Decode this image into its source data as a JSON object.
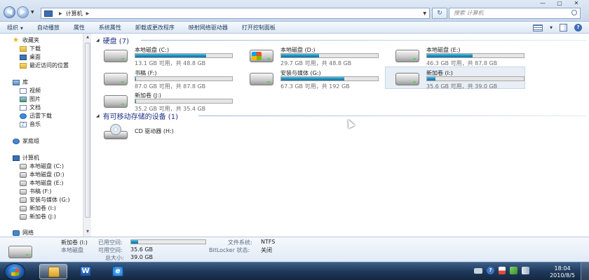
{
  "address": {
    "location": "计算机",
    "search_placeholder": "搜索 计算机"
  },
  "window_controls": {
    "minimize": "—",
    "maximize": "▢",
    "close": "✕"
  },
  "toolbar": {
    "organize": "组织",
    "autoplay": "自动播放",
    "properties": "属性",
    "system_properties": "系统属性",
    "uninstall": "卸载或更改程序",
    "map_drive": "映射网络驱动器",
    "control_panel": "打开控制面板"
  },
  "sidebar": {
    "favorites": "收藏夹",
    "downloads": "下载",
    "desktop": "桌面",
    "recent": "最近访问的位置",
    "libraries": "库",
    "videos": "视频",
    "pictures": "图片",
    "documents": "文档",
    "thunder": "迅雷下载",
    "music": "音乐",
    "homegroup": "家庭组",
    "computer": "计算机",
    "drives": [
      "本地磁盘 (C:)",
      "本地磁盘 (D:)",
      "本地磁盘 (E:)",
      "书稿 (F:)",
      "安装与媒体 (G:)",
      "新加卷 (I:)",
      "新加卷 (J:)"
    ],
    "network": "网络"
  },
  "groups": {
    "hard_disks": "硬盘 (7)",
    "removable": "有可移动存储的设备 (1)"
  },
  "drives": [
    {
      "name": "本地磁盘 (C:)",
      "info": "13.1 GB 可用，共 48.8 GB",
      "used_percent": 73
    },
    {
      "name": "本地磁盘 (D:)",
      "info": "29.7 GB 可用，共 48.8 GB",
      "used_percent": 39
    },
    {
      "name": "本地磁盘 (E:)",
      "info": "46.3 GB 可用，共 87.8 GB",
      "used_percent": 47
    },
    {
      "name": "书稿 (F:)",
      "info": "87.0 GB 可用，共 87.8 GB",
      "used_percent": 1
    },
    {
      "name": "安装与媒体 (G:)",
      "info": "67.3 GB 可用，共 192 GB",
      "used_percent": 65
    },
    {
      "name": "新加卷 (I:)",
      "info": "35.6 GB 可用，共 39.0 GB",
      "used_percent": 9
    },
    {
      "name": "新加卷 (J:)",
      "info": "35.2 GB 可用，共 35.4 GB",
      "used_percent": 1
    }
  ],
  "cd_drive": {
    "name": "CD 驱动器 (H:)"
  },
  "details": {
    "name": "新加卷 (I:)",
    "type": "本地磁盘",
    "used_label": "已用空间:",
    "used_percent": 9,
    "free_label": "可用空间:",
    "free_value": "35.6 GB",
    "total_label": "总大小:",
    "total_value": "39.0 GB",
    "fs_label": "文件系统:",
    "fs_value": "NTFS",
    "bitlocker_label": "BitLocker 状态:",
    "bitlocker_value": "关闭"
  },
  "taskbar": {
    "word_glyph": "W",
    "ie_glyph": "e",
    "time": "18:04",
    "date": "2010/8/5"
  },
  "colors": {
    "accent_bar": "#1f8bb8",
    "group_header": "#1e3287"
  }
}
